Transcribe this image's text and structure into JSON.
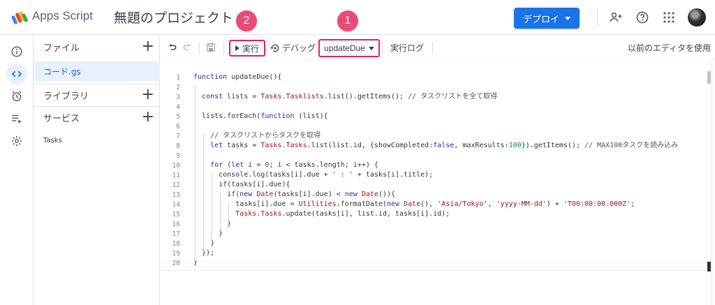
{
  "header": {
    "app_name": "Apps Script",
    "project_title": "無題のプロジェクト",
    "deploy_label": "デプロイ"
  },
  "sidebar_rail": {
    "items": [
      {
        "icon": "info-icon",
        "active": false
      },
      {
        "icon": "code-icon",
        "active": true
      },
      {
        "icon": "alarm-icon",
        "active": false
      },
      {
        "icon": "executions-icon",
        "active": false
      },
      {
        "icon": "gear-icon",
        "active": false
      }
    ]
  },
  "files_panel": {
    "files_label": "ファイル",
    "active_file": "コード.gs",
    "libraries_label": "ライブラリ",
    "services_label": "サービス",
    "service_items": [
      "Tasks"
    ]
  },
  "toolbar": {
    "run_label": "実行",
    "debug_label": "デバッグ",
    "function_selected": "updateDue",
    "log_label": "実行ログ",
    "legacy_label": "以前のエディタを使用"
  },
  "annotations": {
    "badge_1": "1",
    "badge_2": "2"
  },
  "colors": {
    "accent": "#1a73e8",
    "highlight_border": "#e91e63",
    "badge": "#e84b78",
    "active_bg": "#e8f0fe"
  },
  "editor": {
    "line_numbers": [
      "1",
      "2",
      "3",
      "4",
      "5",
      "6",
      "7",
      "8",
      "9",
      "10",
      "11",
      "12",
      "13",
      "14",
      "15",
      "16",
      "17",
      "18",
      "19",
      "20"
    ],
    "lines": [
      "function updateDue(){",
      "",
      "  const lists = Tasks.Tasklists.list().getItems(); // タスクリストを全て取得",
      "",
      "  lists.forEach(function (list){",
      "",
      "    // タスクリストからタスクを取得",
      "    let tasks = Tasks.Tasks.list(list.id, {showCompleted:false, maxResults:100}).getItems(); // MAX100タスクを読み込み",
      "",
      "    for (let i = 0; i < tasks.length; i++) {",
      "      console.log(tasks[i].due + ' : ' + tasks[i].title);",
      "      if(tasks[i].due){",
      "        if(new Date(tasks[i].due) < new Date()){",
      "          tasks[i].due = Utilities.formatDate(new Date(), 'Asia/Tokyo', 'yyyy-MM-dd') + 'T00:00:00.000Z';",
      "          Tasks.Tasks.update(tasks[i], list.id, tasks[i].id);",
      "        }",
      "      }",
      "    }",
      "  });",
      "}"
    ]
  }
}
